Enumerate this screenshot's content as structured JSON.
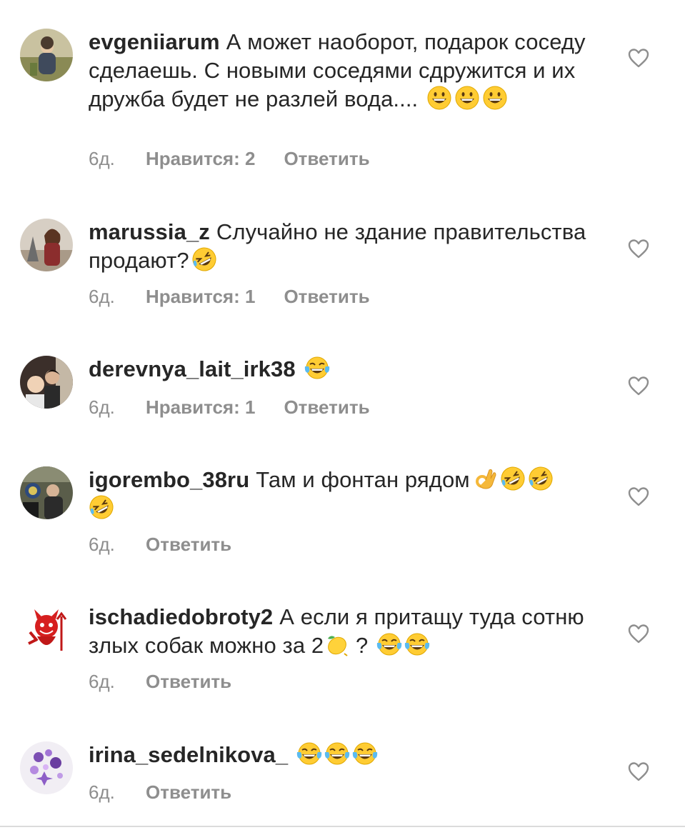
{
  "comments": [
    {
      "username": "evgeniiarum",
      "text": "А может наоборот, подарок соседу сделаешь. С новыми соседями сдружится и их дружба будет не разлей вода....",
      "emojis": [
        "grinning-face",
        "grinning-face",
        "grinning-face"
      ],
      "time": "6д.",
      "likes": "Нравится: 2",
      "reply": "Ответить"
    },
    {
      "username": "marussia_z",
      "text": "Случайно не здание правительства продают?",
      "emojis": [
        "rolling-on-floor-laughing"
      ],
      "time": "6д.",
      "likes": "Нравится: 1",
      "reply": "Ответить"
    },
    {
      "username": "derevnya_lait_irk38",
      "text": "",
      "emojis": [
        "tears-of-joy"
      ],
      "time": "6д.",
      "likes": "Нравится: 1",
      "reply": "Ответить"
    },
    {
      "username": "igorembo_38ru",
      "text": "Там и фонтан рядом",
      "emojis": [
        "ok-hand",
        "rolling-on-floor-laughing",
        "rolling-on-floor-laughing",
        "rolling-on-floor-laughing"
      ],
      "time": "6д.",
      "reply": "Ответить"
    },
    {
      "username": "ischadiedobroty2",
      "text": "А если я притащу туда сотню злых собак можно за 2",
      "text_after": "?",
      "emojis": [
        "lemon",
        "tears-of-joy",
        "tears-of-joy"
      ],
      "time": "6д.",
      "reply": "Ответить"
    },
    {
      "username": "irina_sedelnikova_",
      "text": "",
      "emojis": [
        "tears-of-joy",
        "tears-of-joy",
        "tears-of-joy"
      ],
      "time": "6д.",
      "reply": "Ответить"
    }
  ],
  "icons": {
    "like": "heart-outline-icon"
  },
  "colors": {
    "text": "#262626",
    "meta": "#8e8e8e",
    "heart": "#8e8e8e"
  }
}
